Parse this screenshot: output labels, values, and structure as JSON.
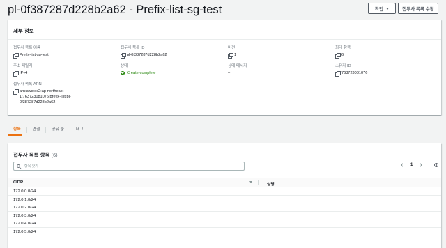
{
  "header": {
    "title": "pl-0f387287d228b2a62 - Prefix-list-sg-test",
    "actions_label": "작업",
    "edit_label": "접두사 목록 수정"
  },
  "details": {
    "title": "세부 정보",
    "fields": {
      "name": {
        "label": "접두사 목록 이름",
        "value": "Prefix-list-sg-test"
      },
      "id": {
        "label": "접두사 목록 ID",
        "value": "pl-0f387287d228b2a62"
      },
      "version": {
        "label": "버전",
        "value": "1"
      },
      "max_entries": {
        "label": "최대 항목",
        "value": "6"
      },
      "address_family": {
        "label": "주소 패밀리",
        "value": "IPv4"
      },
      "state": {
        "label": "상태",
        "value": "Create-complete"
      },
      "state_message": {
        "label": "상태 메시지",
        "value": "–"
      },
      "owner_id": {
        "label": "소유자 ID",
        "value": "763723081076"
      },
      "arn": {
        "label": "접두사 목록 ARN",
        "value_lines": [
          "arn:aws:ec2:ap-northeast-",
          "1:763723081076:prefix-list/pl-",
          "0f387287d228b2a62"
        ]
      }
    }
  },
  "tabs": [
    "항목",
    "연결",
    "공유 중",
    "태그"
  ],
  "entries": {
    "title": "접두사 목록 항목",
    "count": "(6)",
    "search_placeholder": "항목 찾기",
    "page": "1",
    "columns": {
      "cidr": "CIDR",
      "description": "설명"
    },
    "rows": [
      {
        "cidr": "172.0.0.0/24",
        "description": ""
      },
      {
        "cidr": "172.0.1.0/24",
        "description": ""
      },
      {
        "cidr": "172.0.2.0/24",
        "description": ""
      },
      {
        "cidr": "172.0.3.0/24",
        "description": ""
      },
      {
        "cidr": "172.0.4.0/24",
        "description": ""
      },
      {
        "cidr": "172.0.5.0/24",
        "description": ""
      }
    ]
  },
  "colors": {
    "accent": "#ec7211",
    "success": "#1d8102",
    "page_bg": "#f2f3f3"
  },
  "icons": [
    "copy-icon",
    "check-circle-icon",
    "search-icon",
    "chevron-left-icon",
    "chevron-right-icon",
    "gear-icon",
    "sort-icon",
    "caret-down-icon"
  ]
}
